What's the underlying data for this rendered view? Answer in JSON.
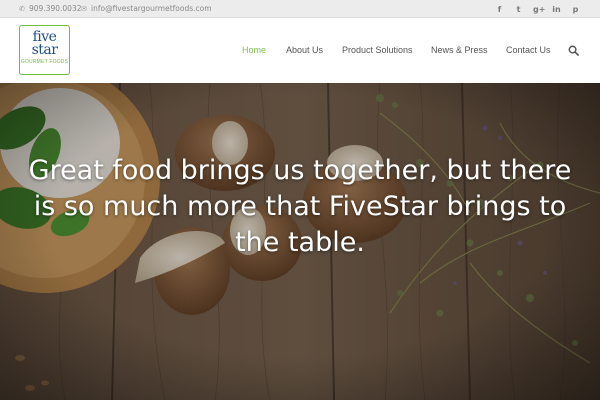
{
  "topbar": {
    "phone": "909.390.0032",
    "email": "info@fivestargourmetfoods.com",
    "phone_icon": "phone-icon",
    "email_icon": "envelope-icon",
    "social": [
      {
        "name": "facebook-icon",
        "glyph": "f"
      },
      {
        "name": "twitter-icon",
        "glyph": "t"
      },
      {
        "name": "google-plus-icon",
        "glyph": "g+"
      },
      {
        "name": "linkedin-icon",
        "glyph": "in"
      },
      {
        "name": "pinterest-icon",
        "glyph": "p"
      }
    ]
  },
  "logo": {
    "line1": "five",
    "line2": "star",
    "line3": "GOURMET FOODS"
  },
  "nav": {
    "home": "Home",
    "about": "About Us",
    "products": "Product Solutions",
    "news": "News & Press",
    "contact": "Contact Us",
    "search_icon": "search-icon"
  },
  "hero": {
    "headline": "Great food brings us together, but there is so much more that FiveStar brings to the table."
  },
  "colors": {
    "accent": "#7cc24e",
    "logo_blue": "#1f4e86",
    "topbar_bg": "#ececec"
  }
}
